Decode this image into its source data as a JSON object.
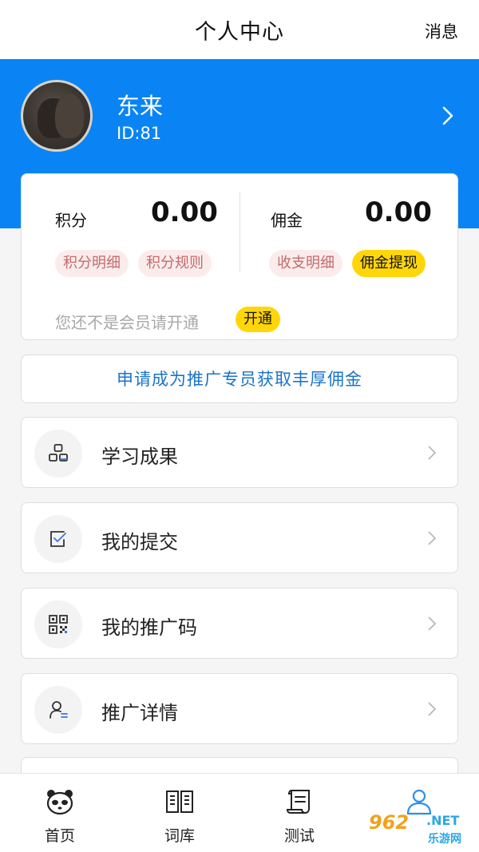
{
  "header": {
    "title": "个人中心",
    "message_label": "消息"
  },
  "profile": {
    "name": "东来",
    "id_text": "ID:81"
  },
  "wallet": {
    "points_label": "积分",
    "points_value": "0.00",
    "commission_label": "佣金",
    "commission_value": "0.00",
    "points_detail": "积分明细",
    "points_rules": "积分规则",
    "income_detail": "收支明细",
    "withdraw": "佣金提现",
    "member_note": "您还不是会员请开通",
    "activate": "开通"
  },
  "promo": {
    "text": "申请成为推广专员获取丰厚佣金"
  },
  "menu": [
    {
      "label": "学习成果",
      "icon": "blocks-icon"
    },
    {
      "label": "我的提交",
      "icon": "check-square-icon"
    },
    {
      "label": "我的推广码",
      "icon": "qrcode-icon"
    },
    {
      "label": "推广详情",
      "icon": "user-list-icon"
    }
  ],
  "tabbar": [
    {
      "label": "首页",
      "icon": "panda-icon"
    },
    {
      "label": "词库",
      "icon": "book-icon"
    },
    {
      "label": "测试",
      "icon": "scroll-icon"
    },
    {
      "label": "",
      "icon": "person-icon"
    }
  ],
  "watermark": {
    "number": "962",
    "suffix": ".NET",
    "text": "乐游网"
  },
  "colors": {
    "primary": "#0a84f5",
    "accent_yellow": "#ffd60a",
    "link_blue": "#1a73c9",
    "pill_pink_bg": "#fbecec"
  }
}
